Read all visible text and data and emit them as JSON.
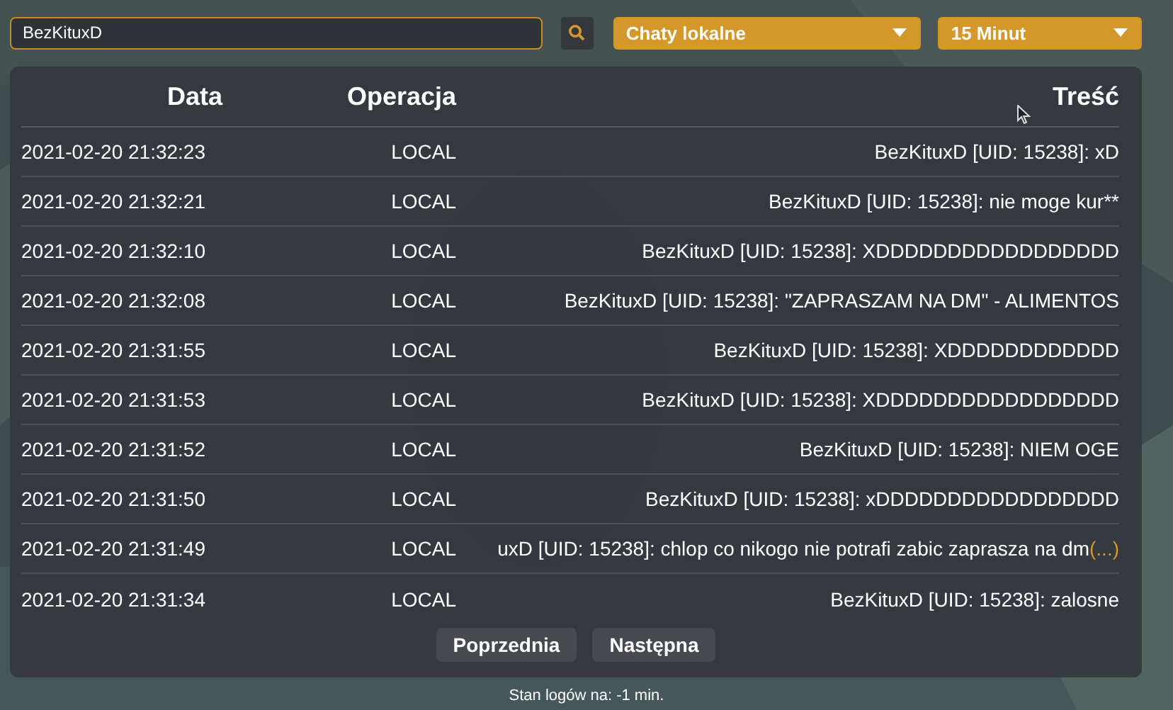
{
  "search": {
    "value": "BezKituxD"
  },
  "filters": [
    {
      "value": "Chaty lokalne"
    },
    {
      "value": "15 Minut"
    }
  ],
  "table": {
    "columns": [
      "Data",
      "Operacja",
      "Treść"
    ],
    "rows": [
      {
        "date": "2021-02-20 21:32:23",
        "operation": "LOCAL",
        "content": "BezKituxD [UID: 15238]: xD"
      },
      {
        "date": "2021-02-20 21:32:21",
        "operation": "LOCAL",
        "content": "BezKituxD [UID: 15238]: nie moge kur**"
      },
      {
        "date": "2021-02-20 21:32:10",
        "operation": "LOCAL",
        "content": "BezKituxD [UID: 15238]: XDDDDDDDDDDDDDDDDD"
      },
      {
        "date": "2021-02-20 21:32:08",
        "operation": "LOCAL",
        "content": "BezKituxD [UID: 15238]: \"ZAPRASZAM NA DM\" - ALIMENTOS"
      },
      {
        "date": "2021-02-20 21:31:55",
        "operation": "LOCAL",
        "content": "BezKituxD [UID: 15238]: XDDDDDDDDDDDD"
      },
      {
        "date": "2021-02-20 21:31:53",
        "operation": "LOCAL",
        "content": "BezKituxD [UID: 15238]: XDDDDDDDDDDDDDDDDD"
      },
      {
        "date": "2021-02-20 21:31:52",
        "operation": "LOCAL",
        "content": "BezKituxD [UID: 15238]: NIEM OGE"
      },
      {
        "date": "2021-02-20 21:31:50",
        "operation": "LOCAL",
        "content": "BezKituxD [UID: 15238]: xDDDDDDDDDDDDDDDDD"
      },
      {
        "date": "2021-02-20 21:31:49",
        "operation": "LOCAL",
        "content": "uxD [UID: 15238]: chlop co nikogo nie potrafi zabic zaprasza na dm",
        "more": "(...)"
      },
      {
        "date": "2021-02-20 21:31:34",
        "operation": "LOCAL",
        "content": "BezKituxD [UID: 15238]: zalosne"
      }
    ]
  },
  "pagination": [
    "Poprzednia",
    "Następna"
  ],
  "status": "Stan logów na: -1 min."
}
